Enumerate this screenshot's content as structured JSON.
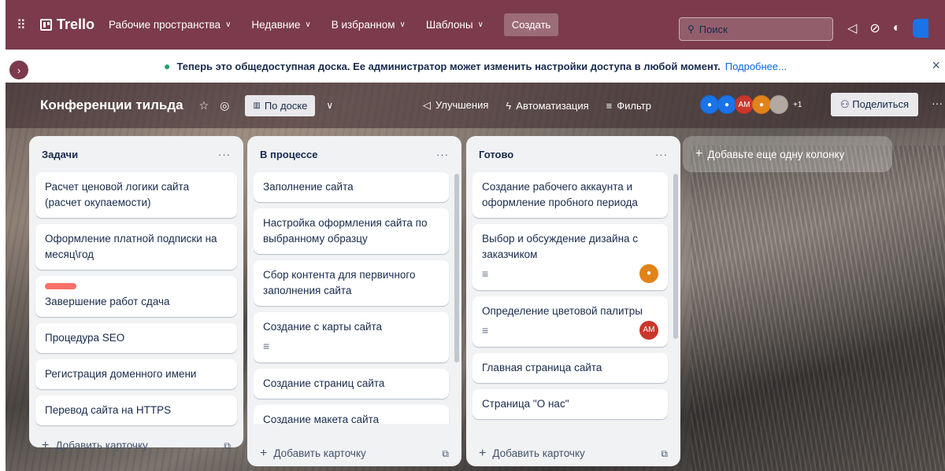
{
  "nav": {
    "logo": "Trello",
    "items": [
      "Рабочие пространства",
      "Недавние",
      "В избранном",
      "Шаблоны"
    ],
    "create": "Создать",
    "search_placeholder": "Поиск"
  },
  "banner": {
    "text": "Теперь это общедоступная доска. Ее администратор может изменить настройки доступа в любой момент.",
    "more": "Подробнее...",
    "close": "×"
  },
  "board": {
    "title": "Конференции тильда",
    "view": "По доске",
    "improvements": "Улучшения",
    "automation": "Автоматизация",
    "filter": "Фильтр",
    "avatar_initials": "АМ",
    "avatar_more": "+1",
    "share": "Поделиться",
    "add_column": "Добавьте еще одну колонку"
  },
  "lists": [
    {
      "title": "Задачи",
      "cards": [
        "Расчет ценовой логики сайта (расчет окупаемости)",
        "Оформление платной подписки на месяц\\год",
        "Завершение работ сдача",
        "Процедура SEO",
        "Регистрация доменного имени",
        "Перевод сайта на HTTPS"
      ]
    },
    {
      "title": "В процессе",
      "cards": [
        "Заполнение сайта",
        "Настройка оформления сайта по выбранному образцу",
        "Сбор контента для первичного заполнения сайта",
        "Создание с карты сайта",
        "Создание страниц сайта",
        "Создание макета сайта"
      ]
    },
    {
      "title": "Готово",
      "cards": [
        "Создание рабочего аккаунта и оформление пробного периода",
        "Выбор и обсуждение дизайна с заказчиком",
        "Определение цветовой палитры",
        "Главная страница сайта",
        "Страница \"О нас\""
      ]
    }
  ],
  "add_card": "Добавить карточку",
  "icons": {
    "apps": "grid-icon",
    "star": "star-icon",
    "globe": "globe-icon",
    "rocket": "rocket-icon",
    "bolt": "bolt-icon",
    "filter": "filter-icon"
  },
  "colors": {
    "nav": "#7b3b4c",
    "label_red": "#f87168",
    "avatar_orange": "#e2831a",
    "avatar_red": "#c9372c"
  }
}
